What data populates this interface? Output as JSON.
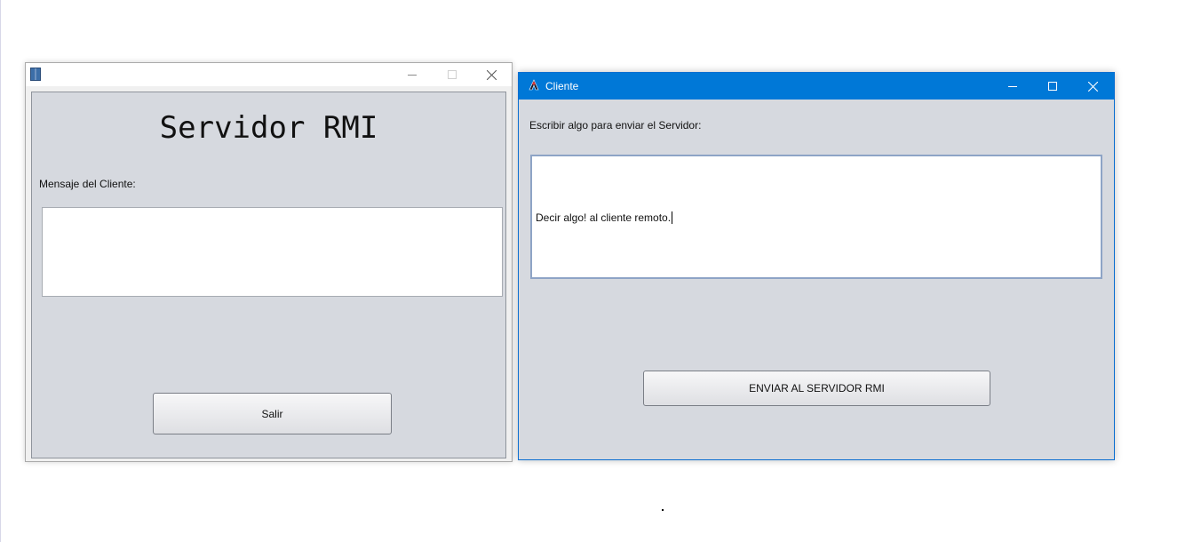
{
  "server_window": {
    "title": "",
    "heading": "Servidor RMI",
    "message_label": "Mensaje del Cliente:",
    "message_value": "",
    "exit_button": "Salir"
  },
  "client_window": {
    "title": "Cliente",
    "prompt_label": "Escribir algo para enviar el Servidor:",
    "input_value": "Decir algo! al cliente remoto.",
    "send_button": "ENVIAR AL SERVIDOR RMI"
  },
  "colors": {
    "active_titlebar": "#0078d7",
    "panel_background": "#d6d9df"
  },
  "icons": {
    "server_app": "app-window-icon",
    "client_app": "java-duke-icon",
    "minimize": "minimize-icon",
    "maximize": "maximize-icon",
    "close": "close-icon"
  }
}
